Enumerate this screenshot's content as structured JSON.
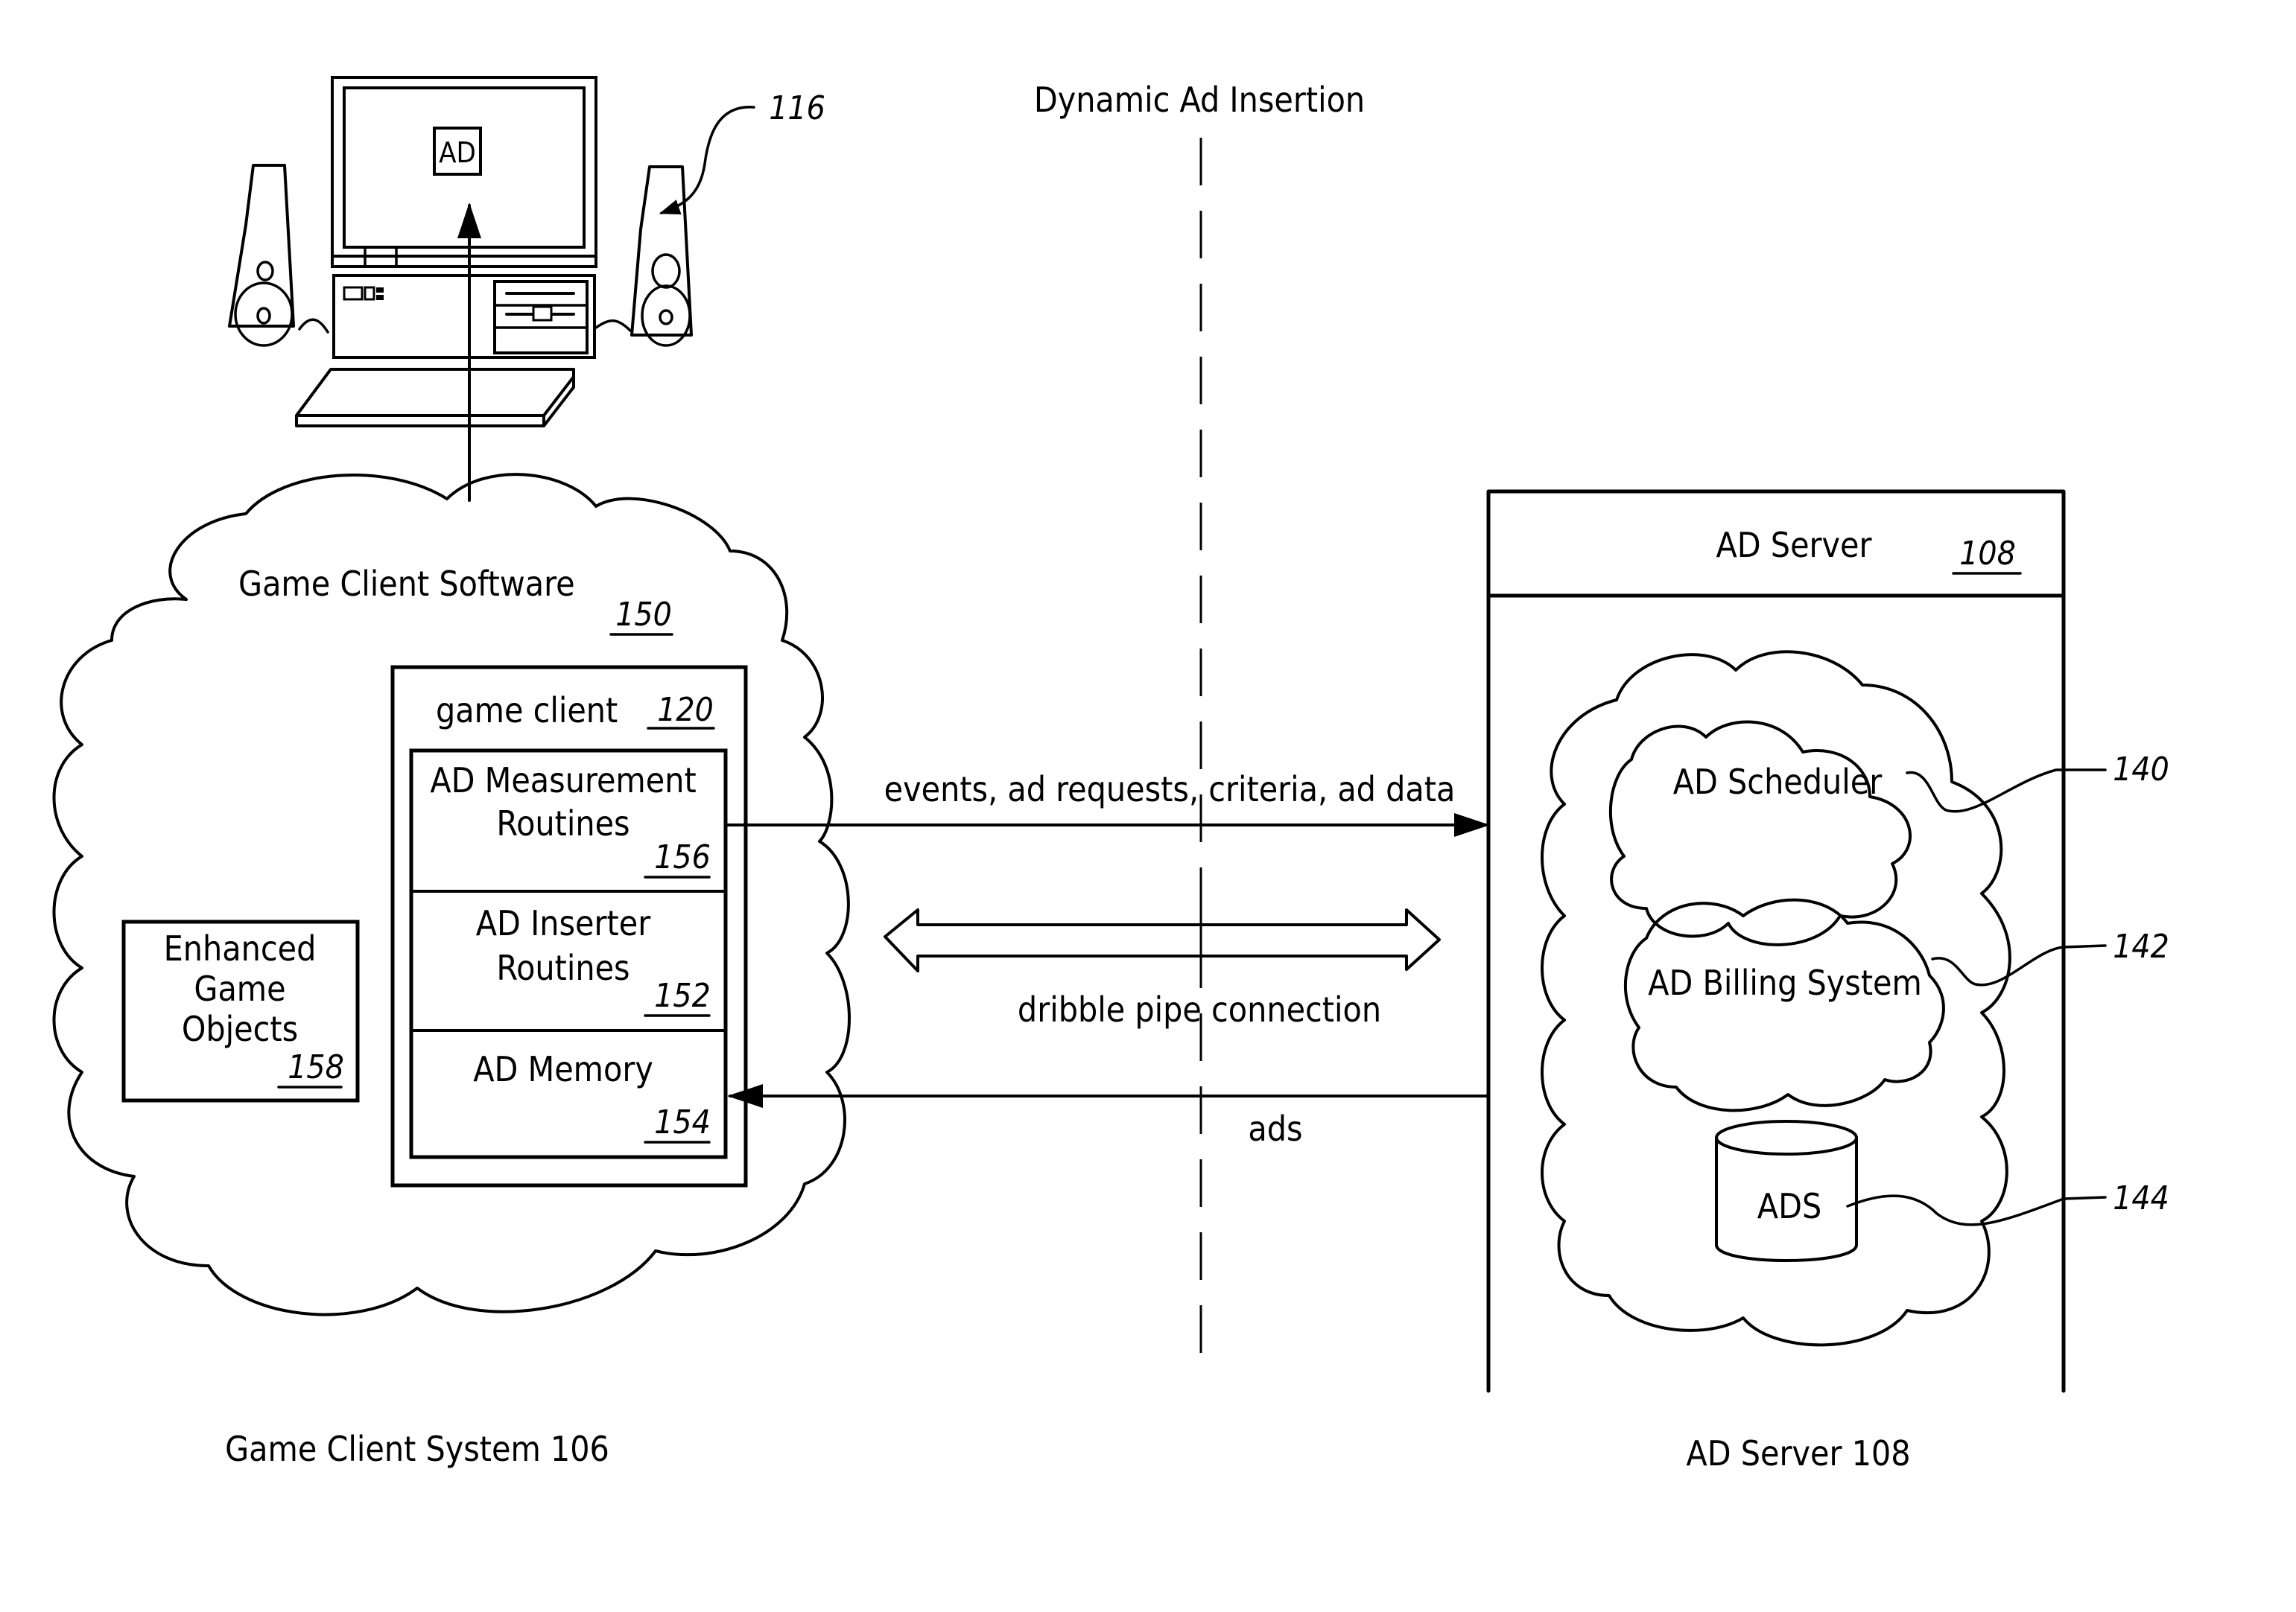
{
  "title": "Dynamic Ad Insertion",
  "computer": {
    "screen_label": "AD",
    "ref": "116"
  },
  "client_cloud": {
    "label": "Game Client Software",
    "ref": "150"
  },
  "game_client": {
    "label": "game client",
    "ref": "120",
    "modules": [
      {
        "line1": "AD Measurement",
        "line2": "Routines",
        "ref": "156"
      },
      {
        "line1": "AD Inserter",
        "line2": "Routines",
        "ref": "152"
      },
      {
        "line1": "AD Memory",
        "line2": "",
        "ref": "154"
      }
    ]
  },
  "enhanced_objects": {
    "line1": "Enhanced",
    "line2": "Game",
    "line3": "Objects",
    "ref": "158"
  },
  "connections": {
    "upstream": "events, ad requests, criteria, ad data",
    "pipe": "dribble pipe connection",
    "downstream": "ads"
  },
  "ad_server": {
    "header": "AD Server",
    "ref": "108",
    "scheduler": {
      "label": "AD Scheduler",
      "ref": "140"
    },
    "billing": {
      "label": "AD Billing System",
      "ref": "142"
    },
    "database": {
      "label": "ADS",
      "ref": "144"
    }
  },
  "captions": {
    "client_system": "Game Client System 106",
    "server": "AD Server 108"
  }
}
